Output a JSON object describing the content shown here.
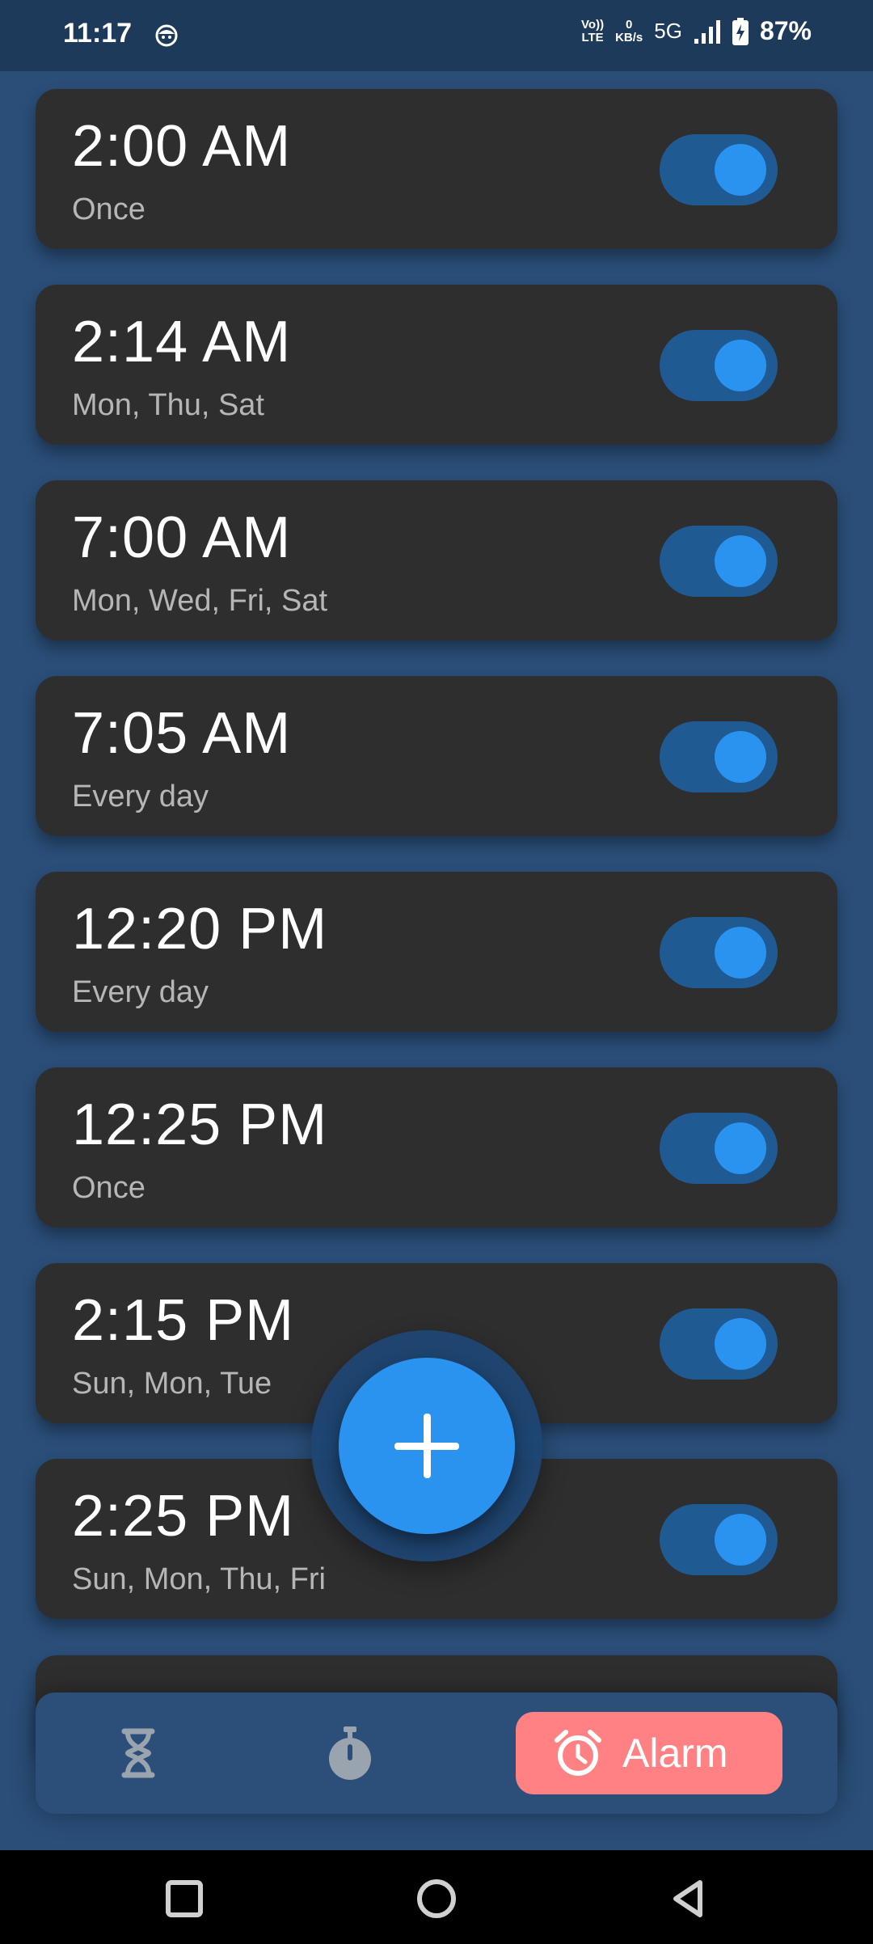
{
  "status_bar": {
    "time": "11:17",
    "volte_top": "Vo))",
    "volte_bottom": "LTE",
    "speed_value": "0",
    "speed_unit": "KB/s",
    "network": "5G",
    "battery_percent": "87%"
  },
  "alarms": [
    {
      "time": "2:00 AM",
      "days": "Once",
      "enabled": true
    },
    {
      "time": "2:14 AM",
      "days": "Mon, Thu, Sat",
      "enabled": true
    },
    {
      "time": "7:00 AM",
      "days": "Mon, Wed, Fri, Sat",
      "enabled": true
    },
    {
      "time": "7:05 AM",
      "days": "Every day",
      "enabled": true
    },
    {
      "time": "12:20 PM",
      "days": "Every day",
      "enabled": true
    },
    {
      "time": "12:25 PM",
      "days": "Once",
      "enabled": true
    },
    {
      "time": "2:15 PM",
      "days": "Sun, Mon, Tue",
      "enabled": true
    },
    {
      "time": "2:25 PM",
      "days": "Sun, Mon, Thu, Fri",
      "enabled": true
    }
  ],
  "bottom_nav": {
    "items": [
      {
        "icon": "hourglass-icon",
        "active": false
      },
      {
        "icon": "stopwatch-icon",
        "active": false
      },
      {
        "icon": "alarm-clock-icon",
        "label": "Alarm",
        "active": true
      }
    ]
  },
  "colors": {
    "background": "#2a4e78",
    "card": "#2e2e2e",
    "accent": "#2a93f0",
    "toggle_track": "#1f5a93",
    "alarm_tab": "#ff8183"
  }
}
